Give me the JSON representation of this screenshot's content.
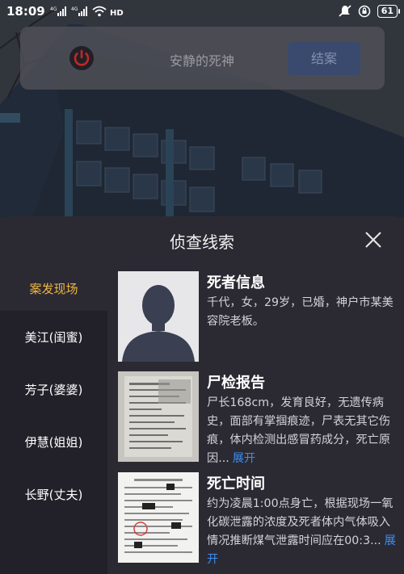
{
  "status_bar": {
    "time": "18:09",
    "net1": "4G",
    "net2": "4G",
    "hd": "HD",
    "battery": "61"
  },
  "top_card": {
    "player_name": "安静的死神",
    "end_button": "结案"
  },
  "panel": {
    "title": "侦查线索"
  },
  "sidebar": {
    "items": [
      {
        "label": "案发现场",
        "active": true
      },
      {
        "label": "美江(闺蜜)",
        "active": false
      },
      {
        "label": "芳子(婆婆)",
        "active": false
      },
      {
        "label": "伊慧(姐姐)",
        "active": false
      },
      {
        "label": "长野(丈夫)",
        "active": false
      }
    ]
  },
  "clues": [
    {
      "title": "死者信息",
      "text": "千代，女，29岁，已婚，神户市某美容院老板。",
      "expand": ""
    },
    {
      "title": "尸检报告",
      "text": "尸长168cm，发育良好，无遗传病史，面部有掌掴痕迹，尸表无其它伤痕，体内检测出感冒药成分，死亡原因...",
      "expand": "展开"
    },
    {
      "title": "死亡时间",
      "text": "约为凌晨1:00点身亡，根据现场一氧化碳泄露的浓度及死者体内气体吸入情况推断煤气泄露时间应在00:3...",
      "expand": "展开"
    }
  ],
  "colors": {
    "active_tab": "#f0b640",
    "link": "#3b8ef0",
    "panel_bg": "#2b2a33",
    "sidebar_bg": "#22212a"
  }
}
